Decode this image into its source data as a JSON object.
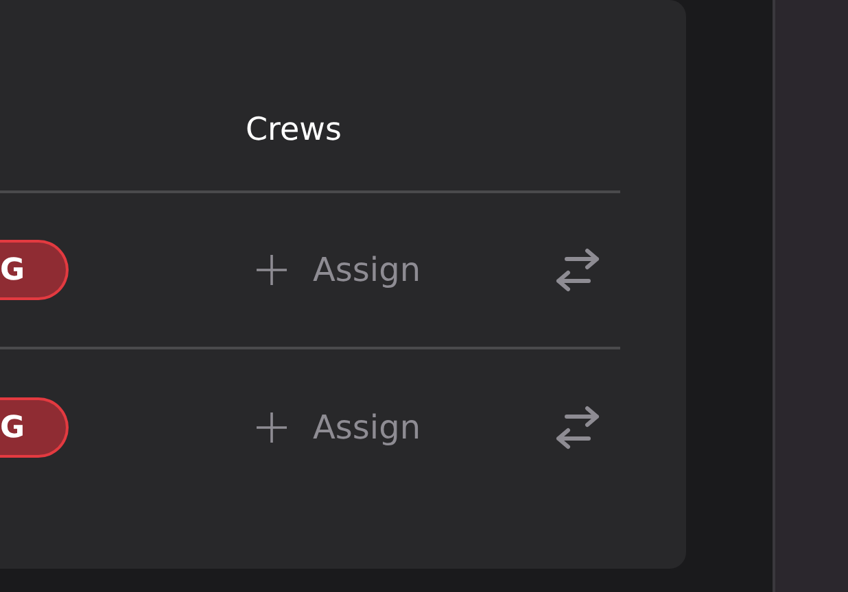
{
  "table": {
    "columns": [
      {
        "label": "Crews"
      }
    ],
    "rows": [
      {
        "status": "G",
        "crew_action": "Assign"
      },
      {
        "status": "G",
        "crew_action": "Assign"
      }
    ]
  }
}
